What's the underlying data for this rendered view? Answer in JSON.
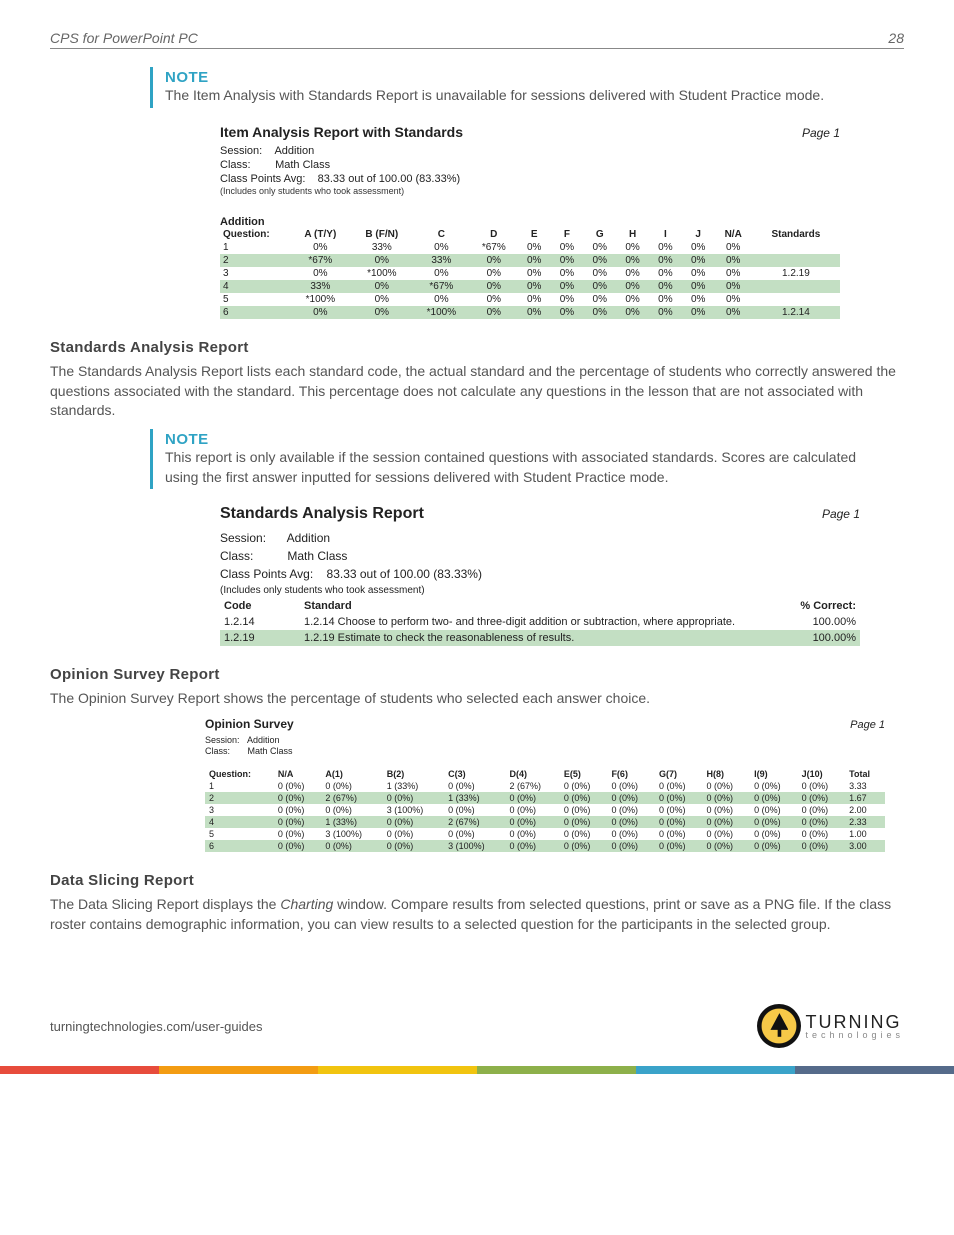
{
  "header": {
    "title": "CPS for PowerPoint PC",
    "page_num": "28"
  },
  "note1": {
    "title": "NOTE",
    "text": "The Item Analysis with Standards Report is unavailable for sessions delivered with Student Practice mode."
  },
  "report1": {
    "title": "Item Analysis Report with Standards",
    "page": "Page 1",
    "session_lbl": "Session:",
    "session": "Addition",
    "class_lbl": "Class:",
    "class": "Math Class",
    "avg_lbl": "Class Points Avg:",
    "avg": "83.33 out of 100.00 (83.33%)",
    "footnote": "(Includes only students who took assessment)",
    "section": "Addition",
    "headers": [
      "Question:",
      "A (T/Y)",
      "B (F/N)",
      "C",
      "D",
      "E",
      "F",
      "G",
      "H",
      "I",
      "J",
      "N/A",
      "Standards"
    ],
    "rows": [
      [
        "1",
        "0%",
        "33%",
        "0%",
        "*67%",
        "0%",
        "0%",
        "0%",
        "0%",
        "0%",
        "0%",
        "0%",
        ""
      ],
      [
        "2",
        "*67%",
        "0%",
        "33%",
        "0%",
        "0%",
        "0%",
        "0%",
        "0%",
        "0%",
        "0%",
        "0%",
        ""
      ],
      [
        "3",
        "0%",
        "*100%",
        "0%",
        "0%",
        "0%",
        "0%",
        "0%",
        "0%",
        "0%",
        "0%",
        "0%",
        "1.2.19"
      ],
      [
        "4",
        "33%",
        "0%",
        "*67%",
        "0%",
        "0%",
        "0%",
        "0%",
        "0%",
        "0%",
        "0%",
        "0%",
        ""
      ],
      [
        "5",
        "*100%",
        "0%",
        "0%",
        "0%",
        "0%",
        "0%",
        "0%",
        "0%",
        "0%",
        "0%",
        "0%",
        ""
      ],
      [
        "6",
        "0%",
        "0%",
        "*100%",
        "0%",
        "0%",
        "0%",
        "0%",
        "0%",
        "0%",
        "0%",
        "0%",
        "1.2.14"
      ]
    ]
  },
  "section_std": {
    "heading": "Standards Analysis Report",
    "text": "The Standards Analysis Report lists each standard code, the actual standard and the percentage of students who correctly answered the questions associated with the standard. This percentage does not calculate any questions in the lesson that are not associated with standards."
  },
  "note2": {
    "title": "NOTE",
    "text": "This report is only available if the session contained questions with associated standards. Scores are calculated using the first answer inputted for sessions delivered with Student Practice mode."
  },
  "report2": {
    "title": "Standards Analysis Report",
    "page": "Page 1",
    "session_lbl": "Session:",
    "session": "Addition",
    "class_lbl": "Class:",
    "class": "Math Class",
    "avg_lbl": "Class Points Avg:",
    "avg": "83.33 out of 100.00 (83.33%)",
    "footnote": "(Includes only students who took assessment)",
    "headers": [
      "Code",
      "Standard",
      "% Correct:"
    ],
    "rows": [
      {
        "code": "1.2.14",
        "std": "1.2.14  Choose to perform two- and three-digit addition or subtraction, where appropriate.",
        "pct": "100.00%"
      },
      {
        "code": "1.2.19",
        "std": "1.2.19  Estimate to check the reasonableness of results.",
        "pct": "100.00%"
      }
    ]
  },
  "section_op": {
    "heading": "Opinion Survey Report",
    "text": "The Opinion Survey Report shows the percentage of students who selected each answer choice."
  },
  "report3": {
    "title": "Opinion Survey",
    "page": "Page 1",
    "session_lbl": "Session:",
    "session": "Addition",
    "class_lbl": "Class:",
    "class": "Math Class",
    "headers": [
      "Question:",
      "N/A",
      "A(1)",
      "B(2)",
      "C(3)",
      "D(4)",
      "E(5)",
      "F(6)",
      "G(7)",
      "H(8)",
      "I(9)",
      "J(10)",
      "Total"
    ],
    "rows": [
      [
        "1",
        "0 (0%)",
        "0 (0%)",
        "1 (33%)",
        "0 (0%)",
        "2 (67%)",
        "0 (0%)",
        "0 (0%)",
        "0 (0%)",
        "0 (0%)",
        "0 (0%)",
        "0 (0%)",
        "3.33"
      ],
      [
        "2",
        "0 (0%)",
        "2 (67%)",
        "0 (0%)",
        "1 (33%)",
        "0 (0%)",
        "0 (0%)",
        "0 (0%)",
        "0 (0%)",
        "0 (0%)",
        "0 (0%)",
        "0 (0%)",
        "1.67"
      ],
      [
        "3",
        "0 (0%)",
        "0 (0%)",
        "3 (100%)",
        "0 (0%)",
        "0 (0%)",
        "0 (0%)",
        "0 (0%)",
        "0 (0%)",
        "0 (0%)",
        "0 (0%)",
        "0 (0%)",
        "2.00"
      ],
      [
        "4",
        "0 (0%)",
        "1 (33%)",
        "0 (0%)",
        "2 (67%)",
        "0 (0%)",
        "0 (0%)",
        "0 (0%)",
        "0 (0%)",
        "0 (0%)",
        "0 (0%)",
        "0 (0%)",
        "2.33"
      ],
      [
        "5",
        "0 (0%)",
        "3 (100%)",
        "0 (0%)",
        "0 (0%)",
        "0 (0%)",
        "0 (0%)",
        "0 (0%)",
        "0 (0%)",
        "0 (0%)",
        "0 (0%)",
        "0 (0%)",
        "1.00"
      ],
      [
        "6",
        "0 (0%)",
        "0 (0%)",
        "0 (0%)",
        "3 (100%)",
        "0 (0%)",
        "0 (0%)",
        "0 (0%)",
        "0 (0%)",
        "0 (0%)",
        "0 (0%)",
        "0 (0%)",
        "3.00"
      ]
    ]
  },
  "section_slice": {
    "heading": "Data Slicing Report",
    "text_a": "The Data Slicing Report displays the ",
    "text_em": "Charting",
    "text_b": " window. Compare results from selected questions, print or save as a PNG file. If the class roster contains demographic information, you can view results to a selected question for the participants in the selected group."
  },
  "footer": {
    "url": "turningtechnologies.com/user-guides",
    "logo_big": "TURNING",
    "logo_small": "technologies"
  }
}
